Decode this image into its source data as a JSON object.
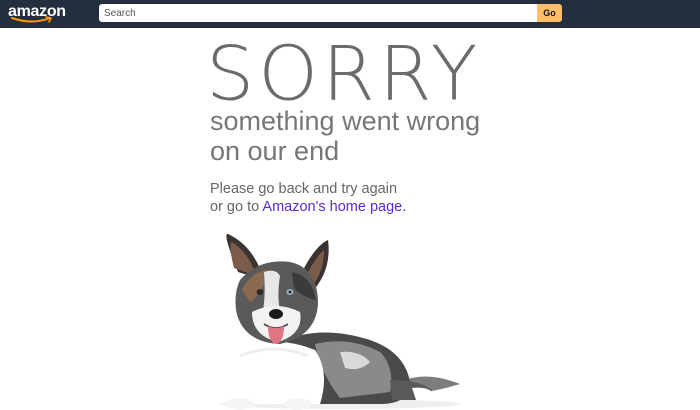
{
  "header": {
    "logo_text": "amazon",
    "search": {
      "placeholder": "Search",
      "value": ""
    },
    "go_label": "Go"
  },
  "error": {
    "heading": "SORRY",
    "subheading_line1": "something went wrong",
    "subheading_line2": "on our end",
    "message_line1": "Please go back and try again",
    "message_line2_prefix": "or go to ",
    "home_link_text": "Amazon's home page."
  },
  "colors": {
    "header_bg": "#232f3e",
    "go_button": "#febd69",
    "logo_smile": "#ff9900",
    "link": "#5a2bd0",
    "heading_text": "#6b6b6b"
  },
  "illustration": "corgi-dog-image"
}
